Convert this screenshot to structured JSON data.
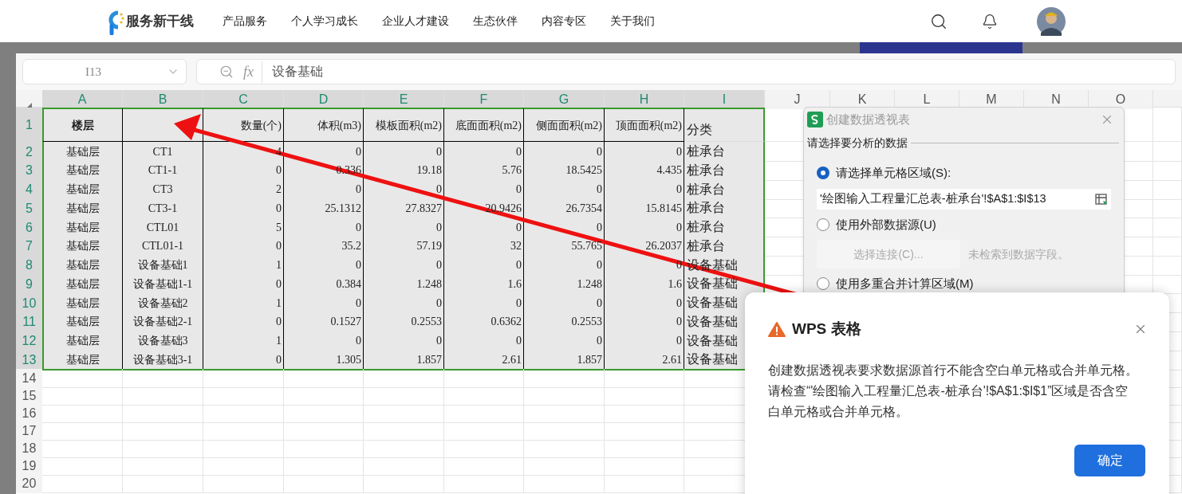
{
  "site_header": {
    "logo_text": "服务新干线",
    "nav": [
      "产品服务",
      "个人学习成长",
      "企业人才建设",
      "生态伙伴",
      "内容专区",
      "关于我们"
    ]
  },
  "name_box": "I13",
  "formula": {
    "fx": "fx",
    "value": "设备基础"
  },
  "sheet": {
    "columns": [
      {
        "label": "A",
        "selected": true
      },
      {
        "label": "B",
        "selected": true
      },
      {
        "label": "C",
        "selected": true
      },
      {
        "label": "D",
        "selected": true
      },
      {
        "label": "E",
        "selected": true
      },
      {
        "label": "F",
        "selected": true
      },
      {
        "label": "G",
        "selected": true
      },
      {
        "label": "H",
        "selected": true
      },
      {
        "label": "I",
        "selected": true
      },
      {
        "label": "J",
        "selected": false
      },
      {
        "label": "K",
        "selected": false
      },
      {
        "label": "L",
        "selected": false
      },
      {
        "label": "M",
        "selected": false
      },
      {
        "label": "N",
        "selected": false
      },
      {
        "label": "O",
        "selected": false
      }
    ],
    "rows": [
      {
        "label": "1",
        "selected": true,
        "cells": [
          "楼层",
          null,
          "数量(个)",
          "体积(m3)",
          "模板面积(m2)",
          "底面面积(m2)",
          "侧面面积(m2)",
          "顶面面积(m2)",
          "分类"
        ]
      },
      {
        "label": "2",
        "selected": true,
        "cells": [
          "基础层",
          "CT1",
          "4",
          "0",
          "0",
          "0",
          "0",
          "0",
          "桩承台"
        ]
      },
      {
        "label": "3",
        "selected": true,
        "cells": [
          "基础层",
          "CT1-1",
          "0",
          "0.336",
          "19.18",
          "5.76",
          "18.5425",
          "4.435",
          "桩承台"
        ]
      },
      {
        "label": "4",
        "selected": true,
        "cells": [
          "基础层",
          "CT3",
          "2",
          "0",
          "0",
          "0",
          "0",
          "0",
          "桩承台"
        ]
      },
      {
        "label": "5",
        "selected": true,
        "cells": [
          "基础层",
          "CT3-1",
          "0",
          "25.1312",
          "27.8327",
          "20.9426",
          "26.7354",
          "15.8145",
          "桩承台"
        ]
      },
      {
        "label": "6",
        "selected": true,
        "cells": [
          "基础层",
          "CTL01",
          "5",
          "0",
          "0",
          "0",
          "0",
          "0",
          "桩承台"
        ]
      },
      {
        "label": "7",
        "selected": true,
        "cells": [
          "基础层",
          "CTL01-1",
          "0",
          "35.2",
          "57.19",
          "32",
          "55.765",
          "26.2037",
          "桩承台"
        ]
      },
      {
        "label": "8",
        "selected": true,
        "cells": [
          "基础层",
          "设备基础1",
          "1",
          "0",
          "0",
          "0",
          "0",
          "0",
          "设备基础"
        ]
      },
      {
        "label": "9",
        "selected": true,
        "cells": [
          "基础层",
          "设备基础1-1",
          "0",
          "0.384",
          "1.248",
          "1.6",
          "1.248",
          "1.6",
          "设备基础"
        ]
      },
      {
        "label": "10",
        "selected": true,
        "cells": [
          "基础层",
          "设备基础2",
          "1",
          "0",
          "0",
          "0",
          "0",
          "0",
          "设备基础"
        ]
      },
      {
        "label": "11",
        "selected": true,
        "cells": [
          "基础层",
          "设备基础2-1",
          "0",
          "0.1527",
          "0.2553",
          "0.6362",
          "0.2553",
          "0",
          "设备基础"
        ]
      },
      {
        "label": "12",
        "selected": true,
        "cells": [
          "基础层",
          "设备基础3",
          "1",
          "0",
          "0",
          "0",
          "0",
          "0",
          "设备基础"
        ]
      },
      {
        "label": "13",
        "selected": true,
        "cells": [
          "基础层",
          "设备基础3-1",
          "0",
          "1.305",
          "1.857",
          "2.61",
          "1.857",
          "2.61",
          "设备基础"
        ]
      },
      {
        "label": "14",
        "selected": false
      },
      {
        "label": "15",
        "selected": false
      },
      {
        "label": "16",
        "selected": false
      },
      {
        "label": "17",
        "selected": false
      },
      {
        "label": "18",
        "selected": false
      },
      {
        "label": "19",
        "selected": false
      },
      {
        "label": "20",
        "selected": false
      }
    ]
  },
  "pivot_dialog": {
    "title": "创建数据透视表",
    "section": "请选择要分析的数据",
    "options": [
      {
        "label": "请选择单元格区域(S):",
        "selected": true
      },
      {
        "label": "使用外部数据源(U)",
        "selected": false
      },
      {
        "label": "使用多重合并计算区域(M)",
        "selected": false
      }
    ],
    "range_value": "'绘图输入工程量汇总表-桩承台'!$A$1:$I$13",
    "connect_button": {
      "label": "选择连接(C)...",
      "disabled": true
    },
    "hint": "未检索到数据字段。"
  },
  "alert_dialog": {
    "title": "WPS 表格",
    "message": "创建数据透视表要求数据源首行不能含空白单元格或合并单元格。请检查“'绘图输入工程量汇总表-桩承台'!$A$1:$I$1”区域是否含空白单元格或合并单元格。",
    "ok_button": "确定"
  }
}
